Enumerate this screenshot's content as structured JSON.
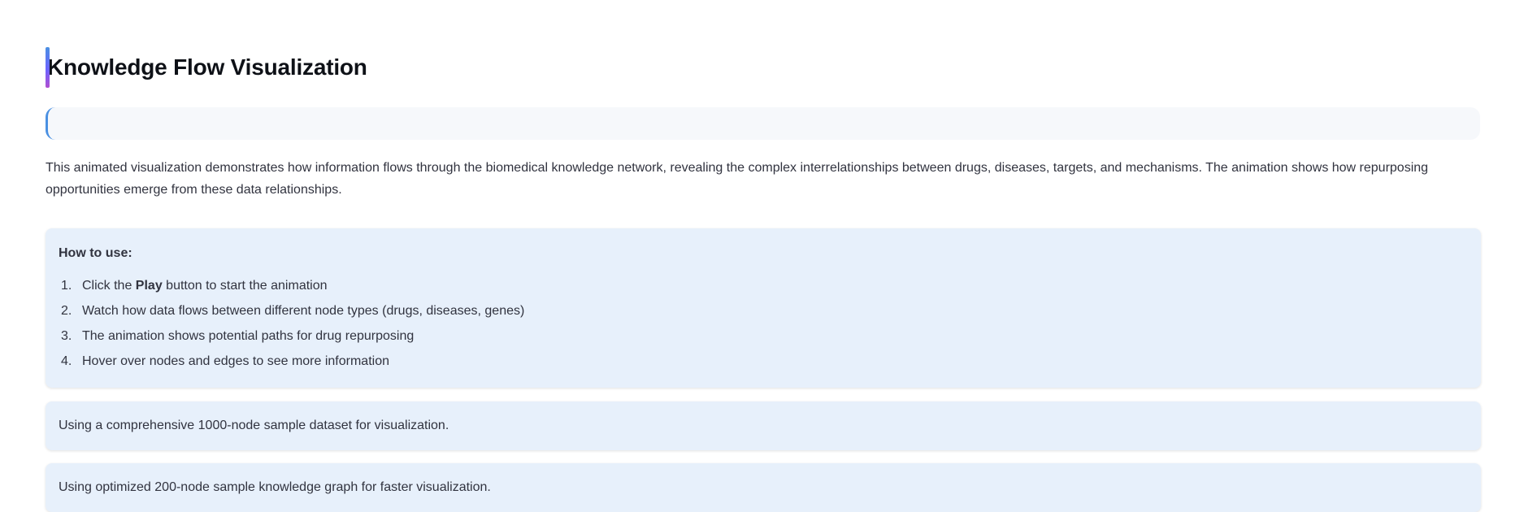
{
  "page": {
    "title": "Knowledge Flow Visualization",
    "description": "This animated visualization demonstrates how information flows through the biomedical knowledge network, revealing the complex interrelationships between drugs, diseases, targets, and mechanisms. The animation shows how repurposing opportunities emerge from these data relationships."
  },
  "howto": {
    "heading": "How to use:",
    "items": [
      {
        "num": "1.",
        "pre": "Click the ",
        "bold": "Play",
        "post": " button to start the animation"
      },
      {
        "num": "2.",
        "pre": "Watch how data flows between different node types (drugs, diseases, genes)",
        "bold": "",
        "post": ""
      },
      {
        "num": "3.",
        "pre": "The animation shows potential paths for drug repurposing",
        "bold": "",
        "post": ""
      },
      {
        "num": "4.",
        "pre": "Hover over nodes and edges to see more information",
        "bold": "",
        "post": ""
      }
    ]
  },
  "messages": {
    "dataset_1000": "Using a comprehensive 1000-node sample dataset for visualization.",
    "dataset_200": "Using optimized 200-node sample knowledge graph for faster visualization."
  },
  "colors": {
    "title_bar_gradient": [
      "#4a90e2",
      "#6c63ff",
      "#b14fd0"
    ],
    "info_background": "#e7f0fb",
    "callout_border": "#4a90e2"
  }
}
